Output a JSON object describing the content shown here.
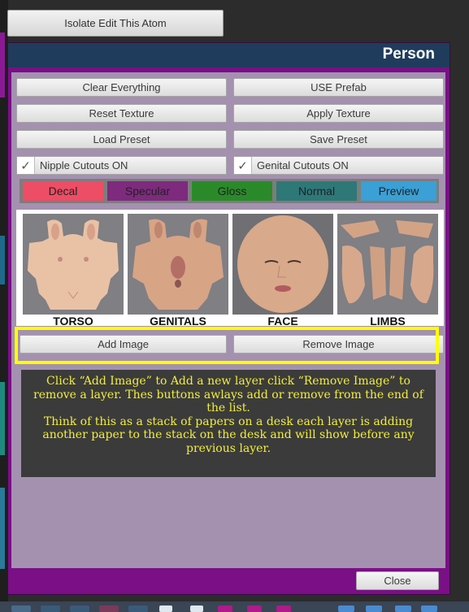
{
  "top_button": "Isolate Edit This Atom",
  "window": {
    "title": "Person",
    "close_label": "Close"
  },
  "actions": {
    "clear_everything": "Clear Everything",
    "use_prefab": "USE Prefab",
    "reset_texture": "Reset Texture",
    "apply_texture": "Apply Texture",
    "load_preset": "Load Preset",
    "save_preset": "Save Preset"
  },
  "toggles": {
    "nipple": {
      "label": "Nipple Cutouts ON",
      "checked": true
    },
    "genital": {
      "label": "Genital Cutouts ON",
      "checked": true
    }
  },
  "tabs": [
    {
      "label": "Decal",
      "color": "#ee4d66"
    },
    {
      "label": "Specular",
      "color": "#7e2a7e"
    },
    {
      "label": "Gloss",
      "color": "#2a8a2a"
    },
    {
      "label": "Normal",
      "color": "#2e7878"
    },
    {
      "label": "Preview",
      "color": "#3aa0d6"
    }
  ],
  "thumbnails": [
    {
      "label": "TORSO"
    },
    {
      "label": "GENITALS"
    },
    {
      "label": "FACE"
    },
    {
      "label": "LIMBS"
    }
  ],
  "layer_buttons": {
    "add": "Add Image",
    "remove": "Remove Image"
  },
  "help": {
    "line1": "Click “Add Image” to Add a new layer  click “Remove Image” to remove a layer. Thes buttons awlays add or remove from the end of the list.",
    "line2": "Think of this as a stack of papers on a desk each layer is adding another paper to the stack on the desk and will show before any previous layer."
  },
  "colors": {
    "window_bg": "#7a0f86",
    "titlebar": "#203c5c",
    "highlight": "#ffff00",
    "help_text": "#f2ee3a"
  }
}
